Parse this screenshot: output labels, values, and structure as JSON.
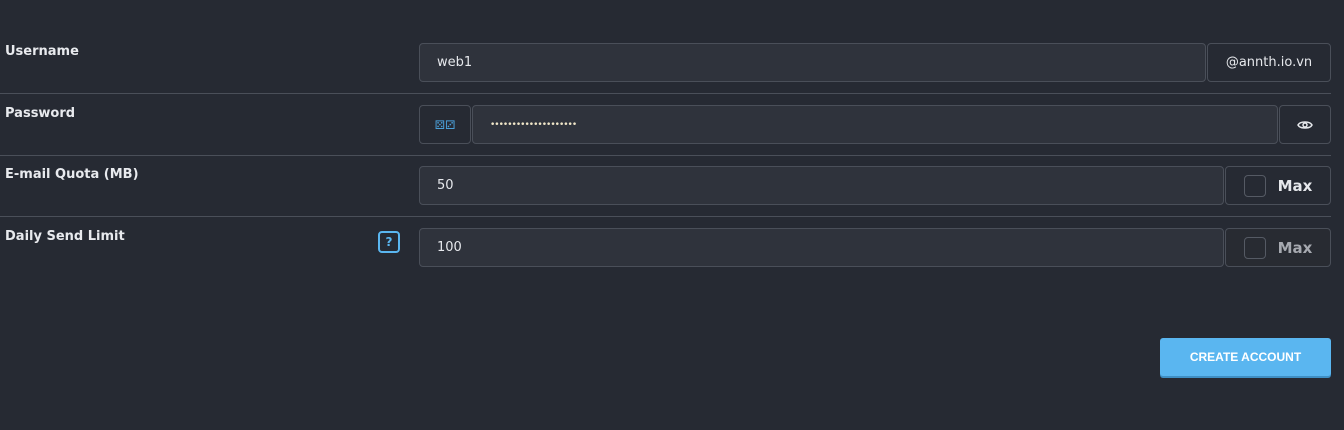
{
  "form": {
    "username": {
      "label": "Username",
      "value": "web1",
      "domain": "@annth.io.vn"
    },
    "password": {
      "label": "Password",
      "value": "••••••••••••••••••••",
      "generate_icon": "dice-icon",
      "toggle_icon": "eye-icon"
    },
    "quota": {
      "label": "E-mail Quota (MB)",
      "value": "50",
      "max_label": "Max",
      "max_checked": false
    },
    "send_limit": {
      "label": "Daily Send Limit",
      "value": "100",
      "max_label": "Max",
      "max_checked": false,
      "help": "?"
    }
  },
  "submit_label": "CREATE ACCOUNT",
  "accent": "#5ab6f0"
}
